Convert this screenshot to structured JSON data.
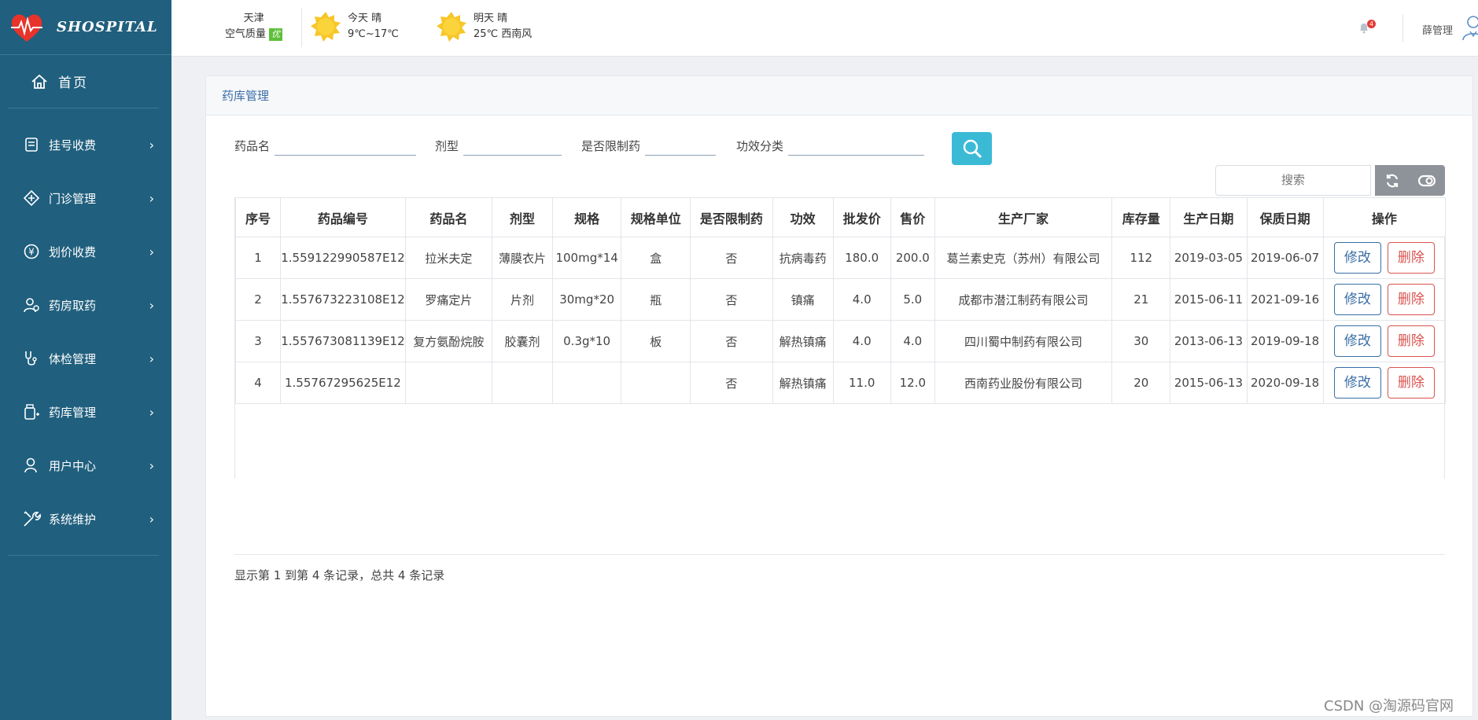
{
  "app": {
    "title": "SHOSPITAL"
  },
  "sidebar": {
    "home": {
      "label": "首页",
      "icon": "home-icon"
    },
    "items": [
      {
        "label": "挂号收费",
        "icon": "register-icon"
      },
      {
        "label": "门诊管理",
        "icon": "clinic-icon"
      },
      {
        "label": "划价收费",
        "icon": "yuan-icon"
      },
      {
        "label": "药房取药",
        "icon": "pharmacy-user-icon"
      },
      {
        "label": "体检管理",
        "icon": "stethoscope-icon"
      },
      {
        "label": "药库管理",
        "icon": "medicine-icon"
      },
      {
        "label": "用户中心",
        "icon": "user-icon"
      },
      {
        "label": "系统维护",
        "icon": "tools-icon"
      }
    ]
  },
  "weather": {
    "city": "天津",
    "air_label": "空气质量",
    "air_value": "优",
    "today": {
      "line1": "今天  晴",
      "line2": "9℃~17℃"
    },
    "tomorrow": {
      "line1": "明天  晴",
      "line2": "25℃ 西南风"
    }
  },
  "header": {
    "notification_count": "4",
    "user_name": "薛管理"
  },
  "panel": {
    "title": "药库管理"
  },
  "filters": {
    "name_label": "药品名",
    "form_label": "剂型",
    "restricted_label": "是否限制药",
    "category_label": "功效分类"
  },
  "toolbar": {
    "search_placeholder": "搜索"
  },
  "table": {
    "columns": [
      "序号",
      "药品编号",
      "药品名",
      "剂型",
      "规格",
      "规格单位",
      "是否限制药",
      "功效",
      "批发价",
      "售价",
      "生产厂家",
      "库存量",
      "生产日期",
      "保质日期",
      "操作"
    ],
    "rows": [
      [
        "1",
        "1.559122990587E12",
        "拉米夫定",
        "薄膜衣片",
        "100mg*14",
        "盒",
        "否",
        "抗病毒药",
        "180.0",
        "200.0",
        "葛兰素史克（苏州）有限公司",
        "112",
        "2019-03-05",
        "2019-06-07"
      ],
      [
        "2",
        "1.557673223108E12",
        "罗痛定片",
        "片剂",
        "30mg*20",
        "瓶",
        "否",
        "镇痛",
        "4.0",
        "5.0",
        "成都市潜江制药有限公司",
        "21",
        "2015-06-11",
        "2021-09-16"
      ],
      [
        "3",
        "1.557673081139E12",
        "复方氨酚烷胺",
        "胶囊剂",
        "0.3g*10",
        "板",
        "否",
        "解热镇痛",
        "4.0",
        "4.0",
        "四川蜀中制药有限公司",
        "30",
        "2013-06-13",
        "2019-09-18"
      ],
      [
        "4",
        "1.55767295625E12",
        "",
        "",
        "",
        "",
        "否",
        "解热镇痛",
        "11.0",
        "12.0",
        "西南药业股份有限公司",
        "20",
        "2015-06-13",
        "2020-09-18"
      ]
    ],
    "edit_label": "修改",
    "delete_label": "删除"
  },
  "footer": {
    "summary": "显示第 1 到第 4 条记录，总共 4 条记录"
  },
  "watermark": "CSDN @淘源码官网",
  "colors": {
    "sidebar": "#205f7e",
    "accent": "#3a6ea5",
    "search_button": "#3bbad6",
    "danger": "#d9534f"
  }
}
